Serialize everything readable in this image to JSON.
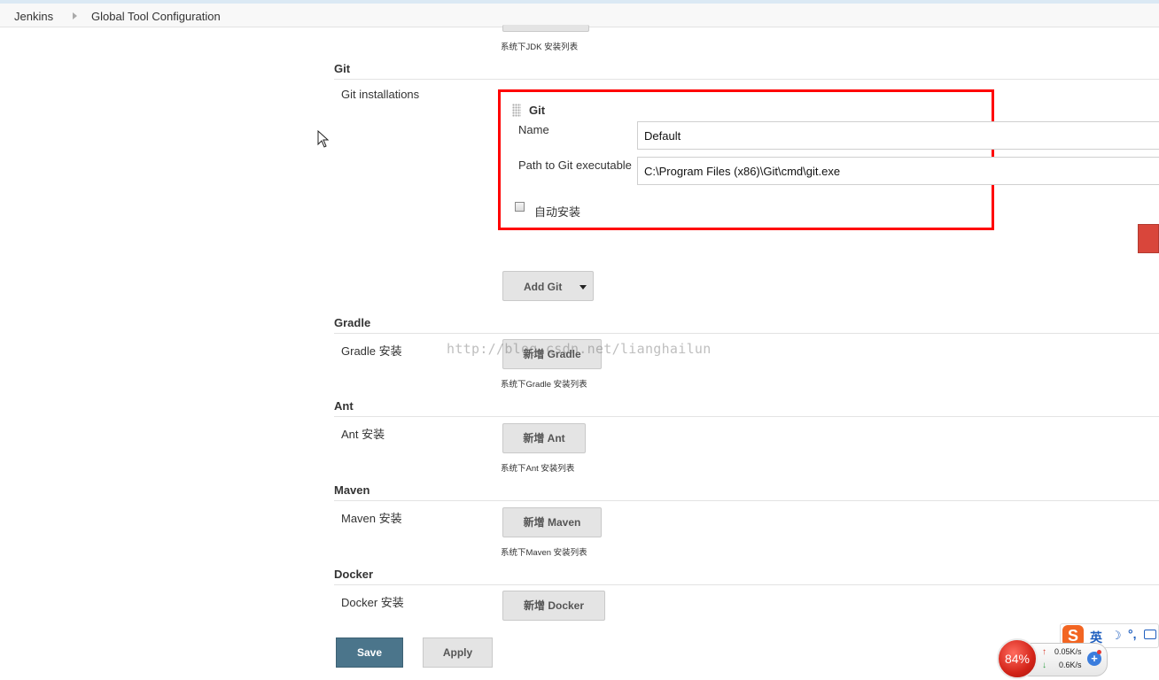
{
  "breadcrumbs": [
    "Jenkins",
    "Global Tool Configuration"
  ],
  "jdk_hint": "系统下JDK 安装列表",
  "git_section": {
    "title": "Git",
    "installations_label": "Git installations",
    "entry_title": "Git",
    "name_label": "Name",
    "name_value": "Default",
    "path_label": "Path to Git executable",
    "path_value": "C:\\Program Files (x86)\\Git\\cmd\\git.exe",
    "auto_install_label": "自动安装",
    "auto_install_checked": false,
    "add_button": "Add Git"
  },
  "gradle_section": {
    "title": "Gradle",
    "label": "Gradle 安装",
    "button": "新增 Gradle",
    "hint": "系统下Gradle 安装列表"
  },
  "ant_section": {
    "title": "Ant",
    "label": "Ant 安装",
    "button": "新增 Ant",
    "hint": "系统下Ant 安装列表"
  },
  "maven_section": {
    "title": "Maven",
    "label": "Maven 安装",
    "button": "新增 Maven",
    "hint": "系统下Maven 安装列表"
  },
  "docker_section": {
    "title": "Docker",
    "label": "Docker 安装",
    "button": "新增 Docker"
  },
  "actions": {
    "save": "Save",
    "apply": "Apply"
  },
  "watermark": "http://blog.csdn.net/lianghailun",
  "tray": {
    "ime_logo": "S",
    "ime_mode": "英",
    "ime_moon": "☽",
    "ime_punct": "°,",
    "cpu_percent": "84%",
    "upload_arrow": "↑",
    "download_arrow": "↓",
    "upload_speed": "0.05K/s",
    "download_speed": "0.6K/s",
    "plus": "+"
  },
  "colors": {
    "highlight_box": "#ff0000",
    "save_button": "#4b758b",
    "button_gray": "#e4e4e4"
  },
  "icons": [
    "mouse-pointer-icon",
    "drag-handle-icon",
    "dropdown-caret-icon",
    "sogou-ime-icon",
    "moon-icon",
    "keyboard-icon",
    "add-icon"
  ]
}
